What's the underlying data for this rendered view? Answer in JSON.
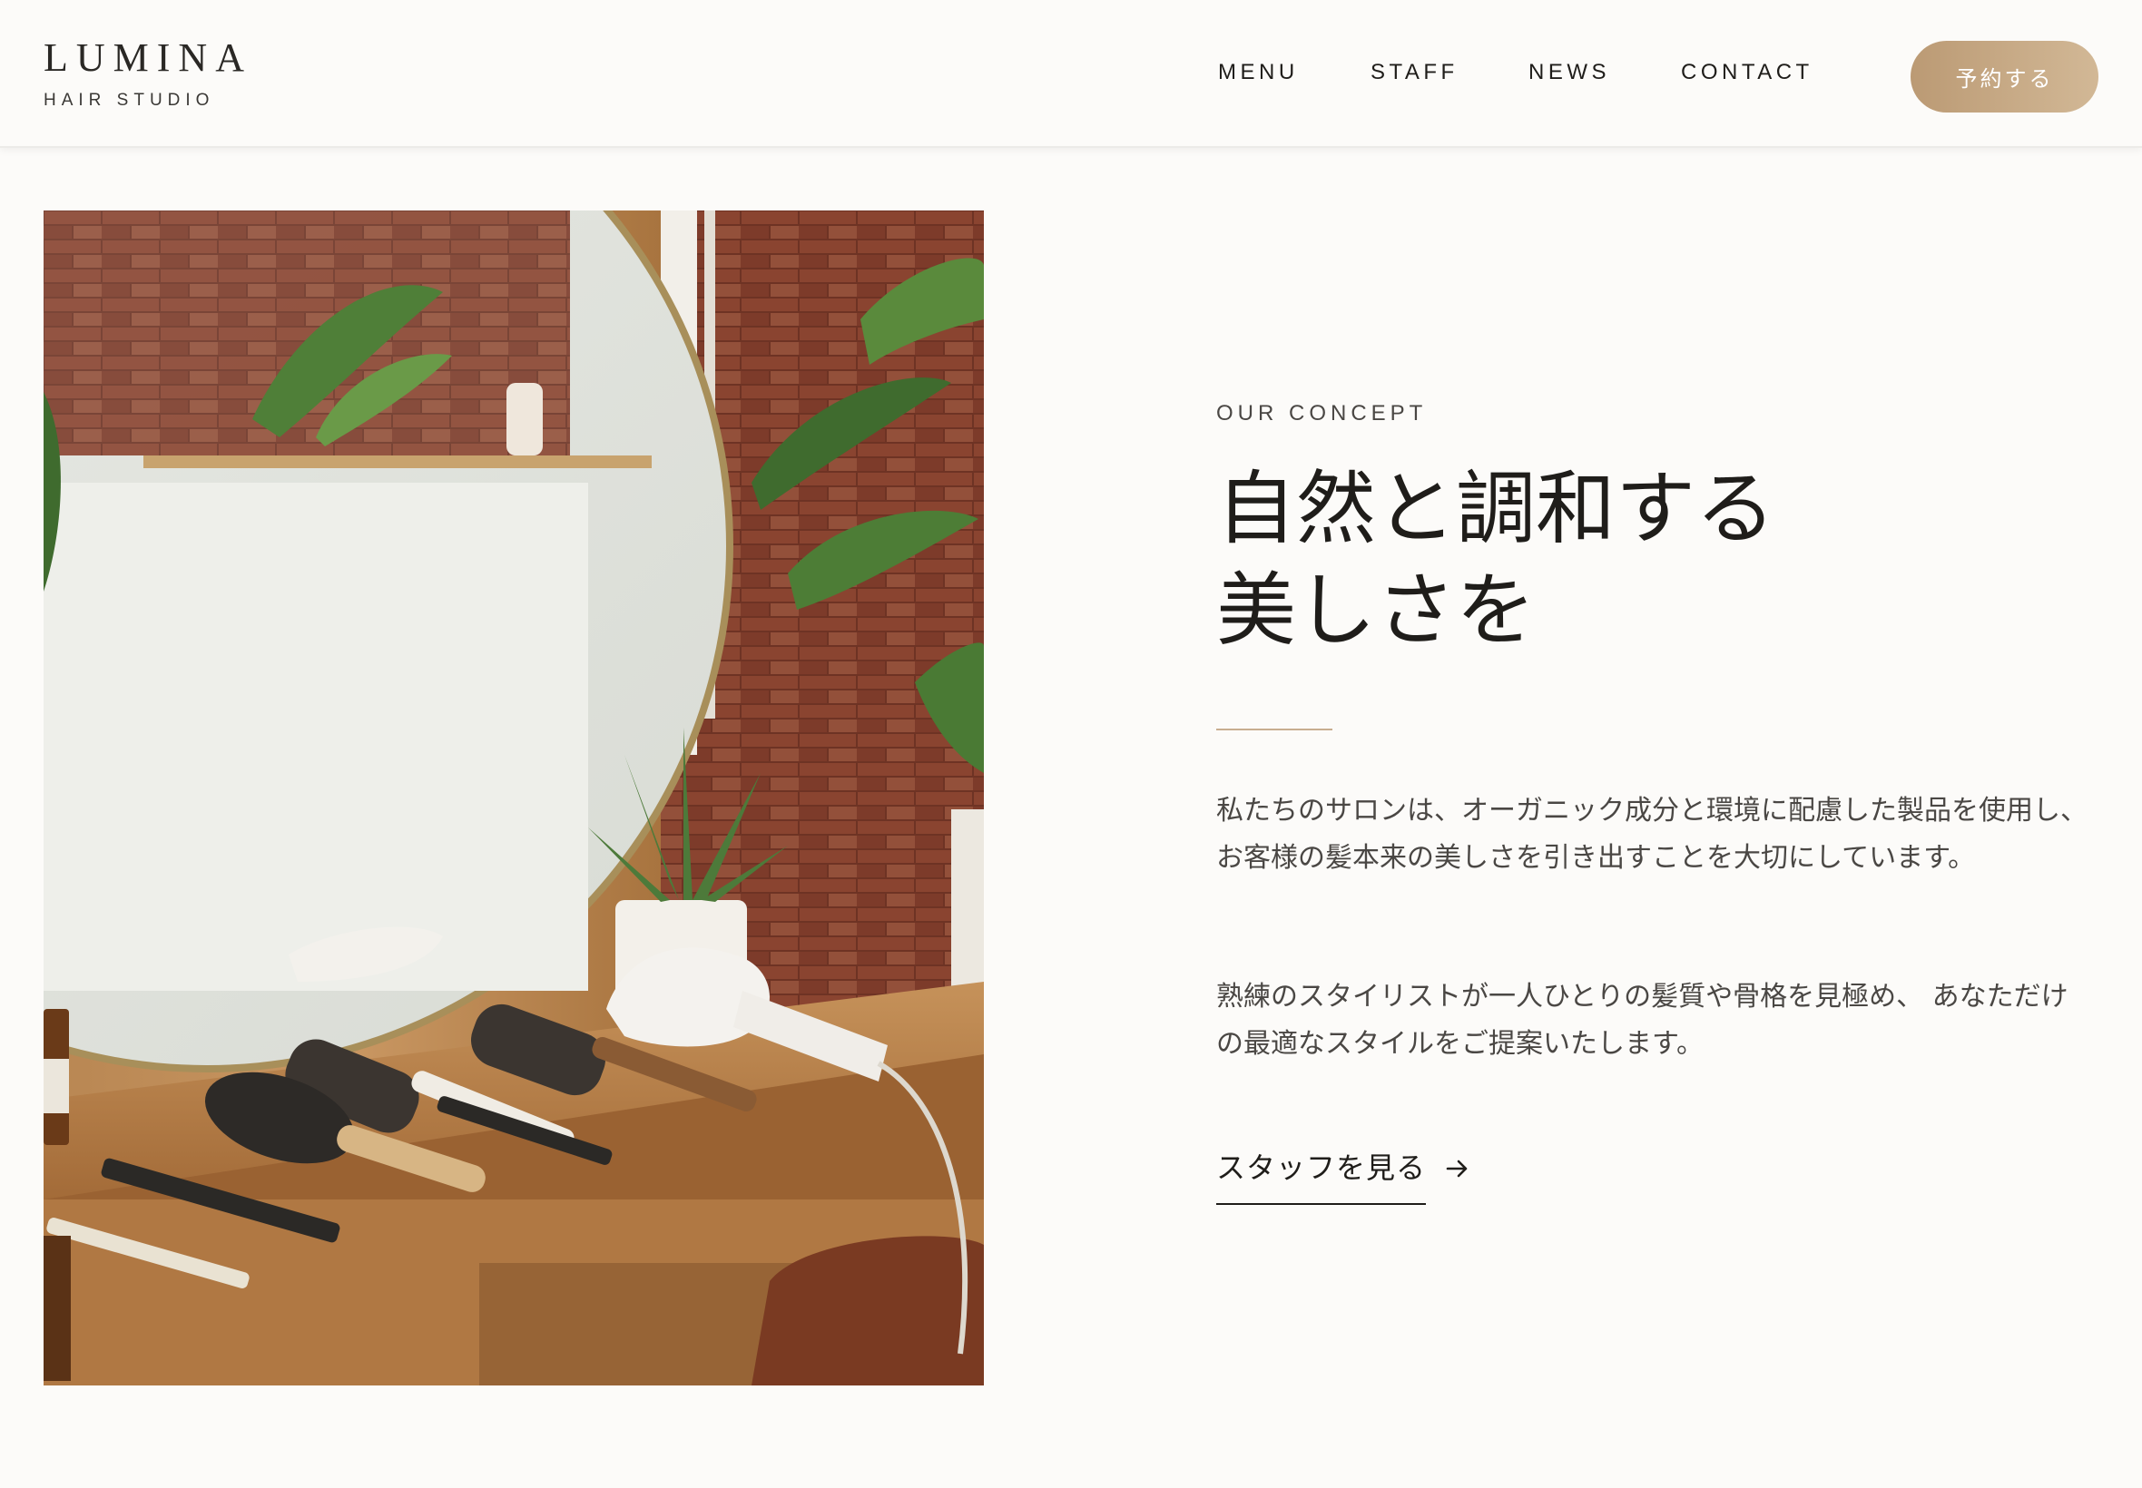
{
  "header": {
    "logo": {
      "name": "LUMINA",
      "subtitle": "HAIR STUDIO"
    },
    "nav": [
      {
        "label": "MENU"
      },
      {
        "label": "STAFF"
      },
      {
        "label": "NEWS"
      },
      {
        "label": "CONTACT"
      }
    ],
    "reserve_button": "予約する"
  },
  "photo": {
    "icon": "salon-station-photo"
  },
  "concept": {
    "eyebrow": "OUR CONCEPT",
    "headline_line1": "自然と調和する",
    "headline_line2": "美しさを",
    "paragraph1": "私たちのサロンは、オーガニック成分と環境に配慮した製品を使用し、 お客様の髪本来の美しさを引き出すことを大切にしています。",
    "paragraph2": "熟練のスタイリストが一人ひとりの髪質や骨格を見極め、 あなただけの最適なスタイルをご提案いたします。",
    "staff_link": "スタッフを見る"
  },
  "colors": {
    "background": "#fcfbf9",
    "accent": "#c4a47f",
    "text": "#1f1d1a",
    "muted": "#4a4744"
  }
}
